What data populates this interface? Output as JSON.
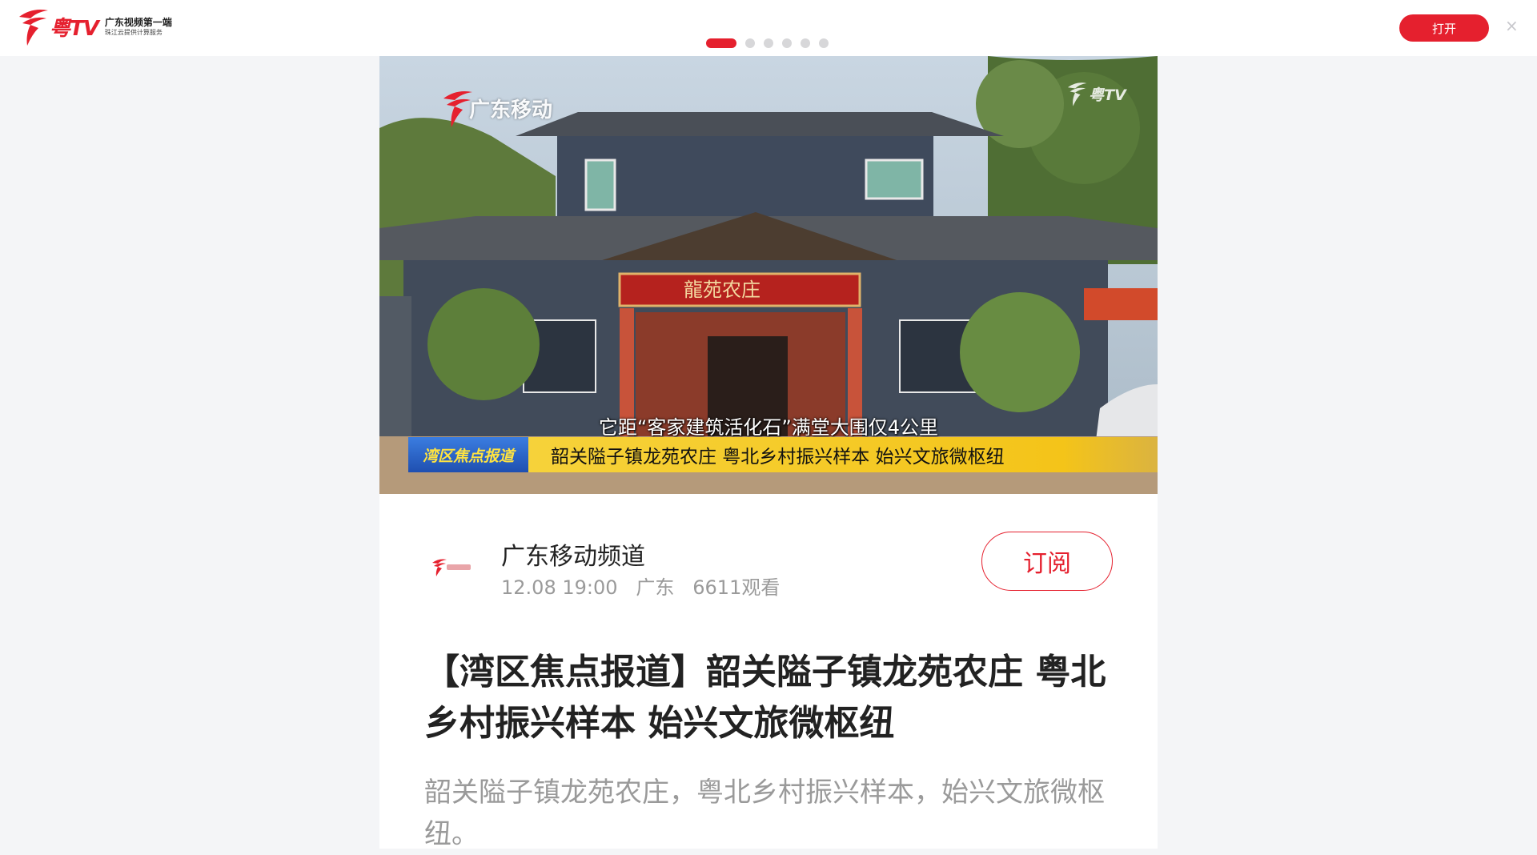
{
  "header": {
    "logo_text": "粤TV",
    "tagline_1": "广东视频第一端",
    "tagline_2": "珠江云提供计算服务",
    "carousel_pages": 6,
    "carousel_active": 1,
    "open_label": "打开",
    "close_label": "×"
  },
  "video": {
    "watermark_left": "广东移动",
    "watermark_right": "粤TV",
    "sign_text": "龍苑农庄",
    "subtitle": "它距“客家建筑活化石”满堂大围仅4公里",
    "ticker_tag": "湾区焦点报道",
    "ticker_text": "韶关隘子镇龙苑农庄  粤北乡村振兴样本 始兴文旅微枢纽"
  },
  "channel": {
    "name": "广东移动频道",
    "meta": "12.08 19:00   广东   6611观看",
    "subscribe_label": "订阅"
  },
  "article": {
    "title": "【湾区焦点报道】韶关隘子镇龙苑农庄 粤北乡村振兴样本 始兴文旅微枢纽",
    "description": "韶关隘子镇龙苑农庄，粤北乡村振兴样本，始兴文旅微枢纽。"
  },
  "colors": {
    "brand_red": "#e5202e",
    "ticker_yellow": "#f4c419",
    "ticker_blue": "#1f4fb0"
  }
}
